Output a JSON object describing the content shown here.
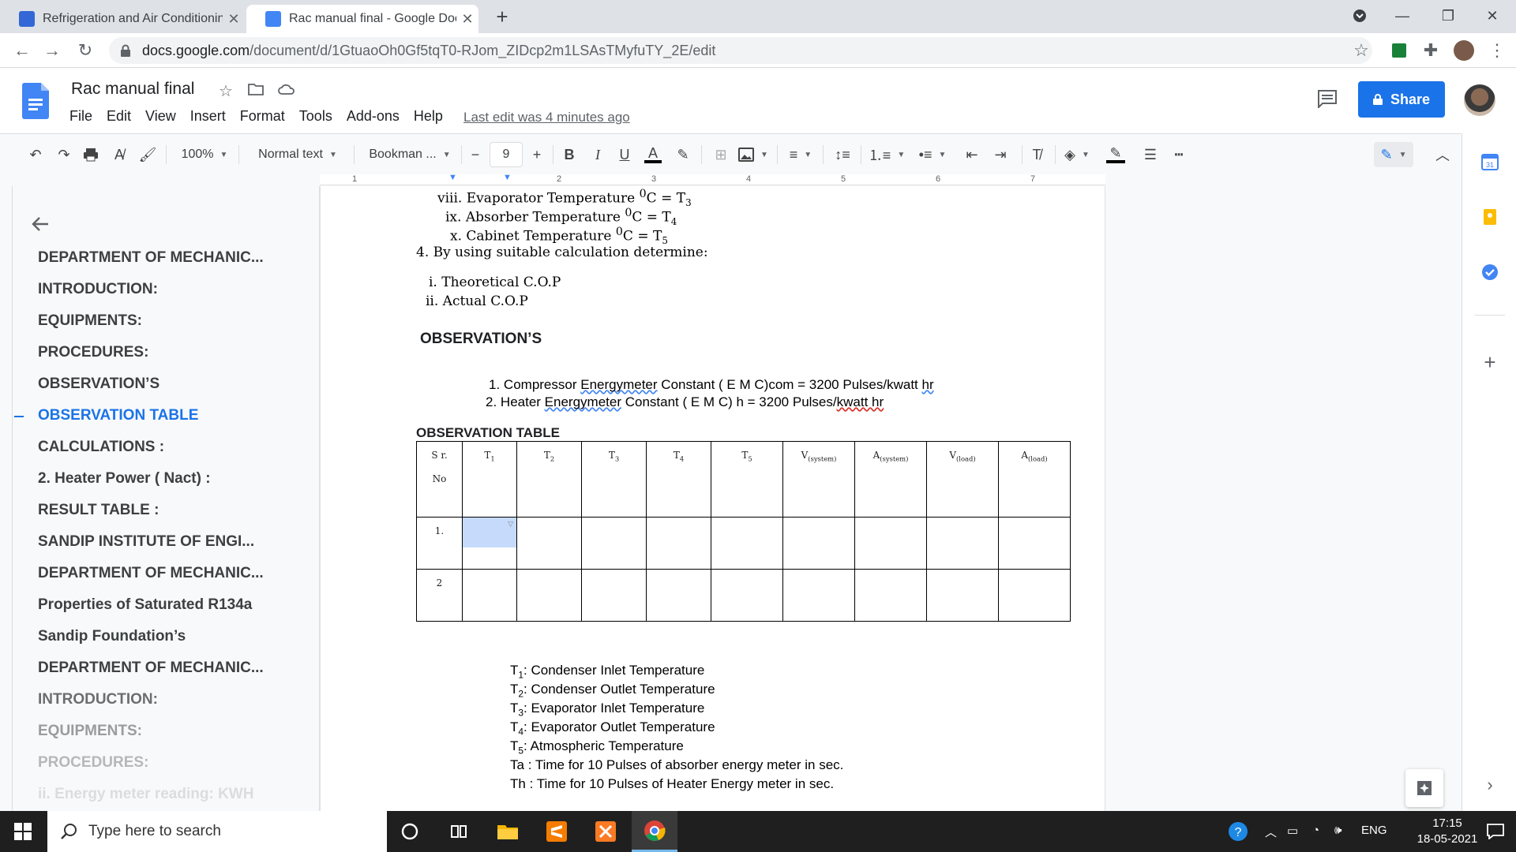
{
  "browser": {
    "tabs": [
      {
        "title": "Refrigeration and Air Conditionin",
        "active": false
      },
      {
        "title": "Rac manual final - Google Docs",
        "active": true
      }
    ],
    "url_host": "docs.google.com",
    "url_path": "/document/d/1GtuaoOh0Gf5tqT0-RJom_ZIDcp2m1LSAsTMyfuTY_2E/edit"
  },
  "docs": {
    "title": "Rac manual final",
    "menu": [
      "File",
      "Edit",
      "View",
      "Insert",
      "Format",
      "Tools",
      "Add-ons",
      "Help"
    ],
    "last_edit": "Last edit was 4 minutes ago",
    "share_label": "Share"
  },
  "toolbar": {
    "zoom": "100%",
    "style": "Normal text",
    "font": "Bookman ...",
    "font_size": "9"
  },
  "ruler": {
    "marks": [
      "1",
      "2",
      "3",
      "4",
      "5",
      "6",
      "7"
    ]
  },
  "outline": {
    "items": [
      {
        "label": "DEPARTMENT OF MECHANIC...",
        "active": false
      },
      {
        "label": "INTRODUCTION:",
        "active": false
      },
      {
        "label": "EQUIPMENTS:",
        "active": false
      },
      {
        "label": "PROCEDURES:",
        "active": false
      },
      {
        "label": "OBSERVATION’S",
        "active": false
      },
      {
        "label": "OBSERVATION TABLE",
        "active": true
      },
      {
        "label": "CALCULATIONS :",
        "active": false
      },
      {
        "label": "2. Heater Power ( Nact) :",
        "active": false
      },
      {
        "label": "RESULT TABLE :",
        "active": false
      },
      {
        "label": "SANDIP INSTITUTE OF ENGI...",
        "active": false
      },
      {
        "label": "DEPARTMENT OF MECHANIC...",
        "active": false
      },
      {
        "label": "Properties of Saturated R134a",
        "active": false
      },
      {
        "label": "Sandip Foundation’s",
        "active": false
      },
      {
        "label": "DEPARTMENT OF MECHANIC...",
        "active": false
      },
      {
        "label": "INTRODUCTION:",
        "active": false
      },
      {
        "label": "EQUIPMENTS:",
        "active": false
      },
      {
        "label": "PROCEDURES:",
        "active": false
      },
      {
        "label": "ii. Energy meter reading: KWH",
        "active": false
      }
    ]
  },
  "document": {
    "list_top": [
      {
        "num": "viii.",
        "text": "Evaporator Temperature",
        "sup": "0",
        "unit": "C = T",
        "sub": "3"
      },
      {
        "num": "ix.",
        "text": "Absorber Temperature",
        "sup": "0",
        "unit": "C = T",
        "sub": "4"
      },
      {
        "num": "x.",
        "text": "Cabinet Temperature",
        "sup": "0",
        "unit": "C = T",
        "sub": "5"
      }
    ],
    "step4": "4. By using suitable calculation determine:",
    "cop_items": [
      "i. Theoretical C.O.P",
      "ii. Actual C.O.P"
    ],
    "observations_heading": "OBSERVATION’S",
    "constants": [
      {
        "num": "1.",
        "pre": "Compressor ",
        "word": "Energymeter",
        "mid": " Constant ( E M C)com = 3200 Pulses/kwatt ",
        "tail": "hr"
      },
      {
        "num": "2.",
        "pre": "Heater ",
        "word": "Energymeter",
        "mid": " Constant ( E M C) h = 3200 Pulses/",
        "tail": "kwatt hr"
      }
    ],
    "table_title": "OBSERVATION TABLE",
    "table": {
      "headers": [
        {
          "main": "S r.",
          "second": "No",
          "sub": ""
        },
        {
          "main": "T",
          "sub": "1"
        },
        {
          "main": "T",
          "sub": "2"
        },
        {
          "main": "T",
          "sub": "3"
        },
        {
          "main": "T",
          "sub": "4"
        },
        {
          "main": "T",
          "sub": "5"
        },
        {
          "main": "V",
          "sub": "(system)"
        },
        {
          "main": "A",
          "sub": "(system)"
        },
        {
          "main": "V",
          "sub": "(load)"
        },
        {
          "main": "A",
          "sub": "(load)"
        }
      ],
      "rows": [
        "1.",
        "2"
      ]
    },
    "legend": [
      {
        "sym": "T",
        "sub": "1",
        "text": ": Condenser Inlet Temperature"
      },
      {
        "sym": "T",
        "sub": "2",
        "text": ": Condenser Outlet Temperature"
      },
      {
        "sym": "T",
        "sub": "3",
        "text": ": Evaporator Inlet Temperature"
      },
      {
        "sym": "T",
        "sub": "4",
        "text": ": Evaporator Outlet Temperature"
      },
      {
        "sym": "T",
        "sub": "5",
        "text": ": Atmospheric Temperature"
      },
      {
        "sym": "Ta",
        "sub": "",
        "text": " : Time for 10 Pulses of absorber energy meter in sec."
      },
      {
        "sym": "Th",
        "sub": "",
        "text": " : Time for 10 Pulses of Heater Energy meter in sec."
      }
    ]
  },
  "taskbar": {
    "search_placeholder": "Type here to search",
    "lang": "ENG",
    "time": "17:15",
    "date": "18-05-2021"
  },
  "colors": {
    "accent": "#1a73e8",
    "docs_blue": "#4285f4",
    "share": "#1a73e8"
  }
}
